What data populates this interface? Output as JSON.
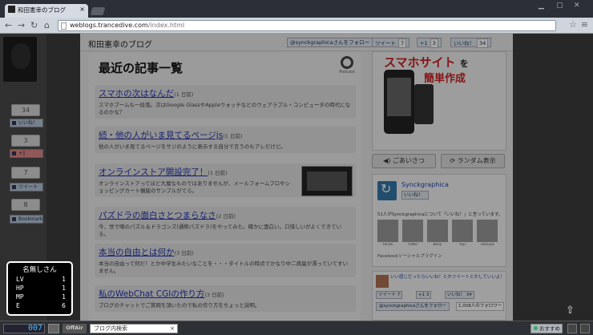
{
  "browser": {
    "tab_title": "和田憲幸のブログ",
    "tab_close": "×",
    "url_host": "weblogs.trancedive.com",
    "url_path": "/index.html",
    "icons": {
      "back": "back-arrow",
      "forward": "forward-arrow",
      "reload": "reload",
      "home": "home",
      "star": "star",
      "wrench": "wrench"
    }
  },
  "left_panel": {
    "like_count": "34",
    "like_label": "いいね！",
    "plusone_count": "3",
    "plusone_label": "+1",
    "tweet_count": "7",
    "tweet_label": "ツイート",
    "bookmark_count": "8",
    "bookmark_label": "Bookmark"
  },
  "header": {
    "site_title": "和田憲幸のブログ",
    "follow_label": "@synckgraphicaさんをフォロー",
    "tweet_label": "ツイート",
    "tweet_count": "7",
    "plusone_label": "+1",
    "plusone_count": "3",
    "like_label": "いいね！",
    "like_count": "34"
  },
  "main": {
    "heading": "最近の記事一覧",
    "podcast_label": "Podcast",
    "posts": [
      {
        "title": "スマホの次はなんだ",
        "date": "(1 日前)",
        "summary": "スマホブームも一段落。次はGoogle GlassやAppleウォッチなどのウェアラブル・コンピュータの時代になるのかな？"
      },
      {
        "title": "続・他の人がいま見てるページjs",
        "date": "(1 日前)",
        "summary": "他の人がいま見てるページをサジのように表示する自分で言うのもアレだけど。"
      },
      {
        "title": "オンラインストア開設完了！",
        "date": "(1 日前)",
        "summary": "オンラインストアってほど大層なものではありませんが、メールフォームプロやショッピングカート機能のサンプルがてら。"
      },
      {
        "title": "パズドラの面白さとつまらなさ",
        "date": "(2 日前)",
        "summary": "今、世で噂のパズル＆ドラゴンズ(通称パズドラ)をやってみた。確かに面白い。口惜しいがよくできている。"
      },
      {
        "title": "本当の自由とは何か",
        "date": "(3 日前)",
        "summary": "本当の自由って何だ！とか中学生みたいなことを・・・タイトルの時点でかなり中二病臭が漂っていてすいません。"
      },
      {
        "title": "私のWebChat CGIの作り方",
        "date": "(3 日前)",
        "summary": "ブログのチャットでご質問を頂いたので私の作り方をちょっと説明。"
      }
    ]
  },
  "sidebar": {
    "ad_line1": "スマホサイト",
    "ad_particle": "を",
    "ad_line2": "簡単作成",
    "greet_button": "ごあいさつ",
    "random_button": "ランダム表示",
    "fb_name": "Synckgraphica",
    "fb_like": "いいね！",
    "fb_text": "51人がSynckgraphicaについて「いいね！」と言っています。",
    "fb_friends": [
      "Hiroki",
      "YUKO",
      "Kenji",
      "Yuji",
      "Tatsuya"
    ],
    "fb_plugin": "Facebookソーシャルプラグイン",
    "tw_links": [
      "いい感じだったらいいね！とかツイートとかしていいよ！"
    ],
    "tw_tweet": "ツイート",
    "tw_tweet_count": "7",
    "tw_plus": "+1",
    "tw_plus_count": "3",
    "tw_like": "いいね！",
    "tw_like_count": "34",
    "tw_follow": "@synckgraphicaさんをフォロー",
    "tw_followers": "1,008人のフォロワー"
  },
  "hud": {
    "name": "名無しさん",
    "stats": [
      {
        "k": "LV",
        "v": "1"
      },
      {
        "k": "HP",
        "v": "1"
      },
      {
        "k": "MP",
        "v": "1"
      },
      {
        "k": "E",
        "v": "6"
      }
    ]
  },
  "statusbar": {
    "counter": "007",
    "offair": "OffAir",
    "search_placeholder": "ブログ内検索",
    "recommend": "おすすめ"
  }
}
